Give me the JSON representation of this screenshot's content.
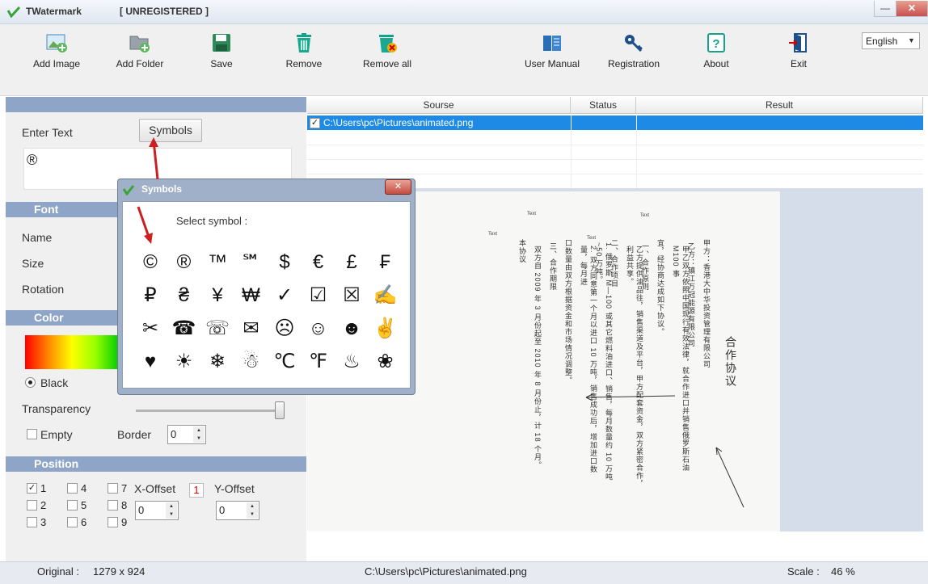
{
  "window": {
    "title": "TWatermark",
    "registration_status": "[ UNREGISTERED ]",
    "minimize": "—",
    "close": "✕"
  },
  "toolbar": {
    "add_image": "Add Image",
    "add_folder": "Add Folder",
    "save": "Save",
    "remove": "Remove",
    "remove_all": "Remove all",
    "user_manual": "User Manual",
    "registration": "Registration",
    "about": "About",
    "exit": "Exit"
  },
  "language": {
    "selected": "English"
  },
  "text_section": {
    "enter_text_label": "Enter Text",
    "symbols_button": "Symbols",
    "text_value": "®"
  },
  "font_section": {
    "header": "Font",
    "name_label": "Name",
    "size_label": "Size",
    "rotation_label": "Rotation"
  },
  "color_section": {
    "header": "Color",
    "black_label": "Black",
    "transparency_label": "Transparency",
    "transparency_level": 0.98,
    "empty_label": "Empty",
    "border_label": "Border",
    "border_value": "0"
  },
  "position_section": {
    "header": "Position",
    "positions": [
      "1",
      "2",
      "3",
      "4",
      "5",
      "6",
      "7",
      "8",
      "9"
    ],
    "checked_position": "1",
    "x_offset_label": "X-Offset",
    "x_offset_value": "0",
    "y_offset_label": "Y-Offset",
    "y_offset_value": "0",
    "current_badge": "1"
  },
  "file_table": {
    "columns": [
      "Sourse",
      "Status",
      "Result"
    ],
    "rows": [
      {
        "source": "C:\\Users\\pc\\Pictures\\animated.png",
        "status": "",
        "result": "",
        "checked": true
      }
    ]
  },
  "preview": {
    "text_marks": [
      "Text",
      "Text",
      "Text"
    ],
    "doc_title": "合作协议",
    "doc_columns": [
      "甲方：香港大中华投资管理有限公司",
      "乙方：镇江万冠能源有限公司",
      "甲乙双方依照中国现行有效法律，就合作进口并销售俄罗斯石油 M100 事",
      "宜，经协商达成如下协议。",
      "一、合作原则",
      "乙方提供油品往，销售渠道及平台，甲方配套资金，双方紧密合作，利益共享。",
      "二、合作项目",
      "1. 俄罗斯 M—100 或其它燃料油进口、销售，每月数量约 10 万吨~50 万吨。",
      "2. 双方同意第一个月以进口 10 万吨，销售成功后，增加进口数量，每月进",
      "口数量由双方根据资金和市场情况调整。",
      "三、合作期限",
      "双方自 2009 年 3 月份起至 2010 年 8 月份止，计 18 个月。",
      "本协议"
    ]
  },
  "symbols_dialog": {
    "title": "Symbols",
    "prompt": "Select symbol :",
    "symbols": [
      "©",
      "®",
      "™",
      "℠",
      "$",
      "€",
      "£",
      "₣",
      "₽",
      "₴",
      "¥",
      "₩",
      "✓",
      "☑",
      "☒",
      "✍",
      "✂",
      "☎",
      "☏",
      "✉",
      "☹",
      "☺",
      "☻",
      "✌",
      "♥",
      "☀",
      "❄",
      "☃",
      "℃",
      "℉",
      "♨",
      "❀"
    ]
  },
  "status_bar": {
    "original_label": "Original :",
    "original_value": "1279 x 924",
    "path": "C:\\Users\\pc\\Pictures\\animated.png",
    "scale_label": "Scale :",
    "scale_value": "46 %"
  },
  "colors": {
    "accent": "#1e8ae6",
    "band": "#8ea5c8",
    "dialog": "#9fb0c8",
    "arrow": "#cc1f1f"
  }
}
